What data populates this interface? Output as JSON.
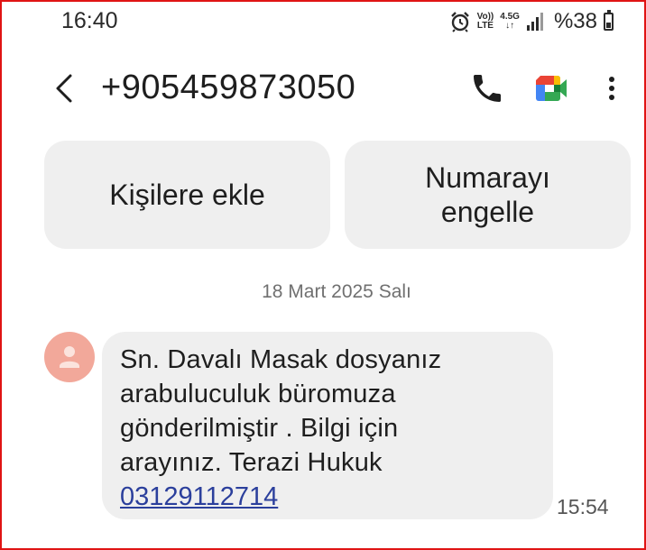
{
  "status_bar": {
    "time": "16:40",
    "volte_top": "Vo))",
    "volte_bottom": "LTE",
    "network_top": "4.5G",
    "network_bottom": "↓↑",
    "battery": "%38",
    "icons": [
      "alarm-icon",
      "volte-icon",
      "network-arrows-icon",
      "signal-icon",
      "battery-icon"
    ]
  },
  "header": {
    "title": "+905459873050",
    "icons": [
      "back-arrow-icon",
      "phone-icon",
      "meet-video-icon",
      "more-vertical-icon"
    ]
  },
  "actions": {
    "add_contact": "Kişilere ekle",
    "block_line1": "Numarayı",
    "block_line2": "engelle"
  },
  "conversation": {
    "date": "18 Mart 2025 Salı",
    "message": {
      "line1": "Sn. Davalı Masak dosyanız",
      "line2": "arabuluculuk büromuza",
      "line3": "gönderilmiştir . Bilgi için",
      "line4": "arayınız. Terazi Hukuk",
      "link": "03129112714",
      "time": "15:54"
    }
  },
  "colors": {
    "bubble": "#efefef",
    "avatar": "#f2a89a",
    "link": "#2b3f9c",
    "frame": "#e01414"
  }
}
